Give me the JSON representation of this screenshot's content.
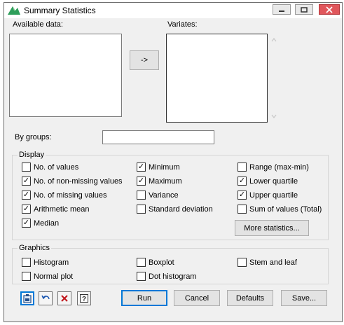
{
  "window": {
    "title": "Summary Statistics"
  },
  "available_data": {
    "label": "Available data:"
  },
  "move_button": {
    "label": "->"
  },
  "variates": {
    "label": "Variates:"
  },
  "by_groups": {
    "label": "By groups:",
    "value": ""
  },
  "display": {
    "title": "Display",
    "options": [
      {
        "label": "No. of values",
        "checked": false
      },
      {
        "label": "No. of non-missing values",
        "checked": true
      },
      {
        "label": "No. of missing values",
        "checked": true
      },
      {
        "label": "Arithmetic mean",
        "checked": true
      },
      {
        "label": "Median",
        "checked": true
      },
      {
        "label": "Minimum",
        "checked": true
      },
      {
        "label": "Maximum",
        "checked": true
      },
      {
        "label": "Variance",
        "checked": false
      },
      {
        "label": "Standard deviation",
        "checked": false
      },
      {
        "label": "Range (max-min)",
        "checked": false
      },
      {
        "label": "Lower quartile",
        "checked": true
      },
      {
        "label": "Upper quartile",
        "checked": true
      },
      {
        "label": "Sum of values (Total)",
        "checked": false
      }
    ],
    "more_button": "More statistics..."
  },
  "graphics": {
    "title": "Graphics",
    "options": [
      {
        "label": "Histogram",
        "checked": false
      },
      {
        "label": "Normal plot",
        "checked": false
      },
      {
        "label": "Boxplot",
        "checked": false
      },
      {
        "label": "Dot histogram",
        "checked": false
      },
      {
        "label": "Stem and leaf",
        "checked": false
      }
    ]
  },
  "buttons": {
    "run": "Run",
    "cancel": "Cancel",
    "defaults": "Defaults",
    "save": "Save..."
  },
  "icons": {
    "app": "genstat-logo-icon",
    "minimize": "minimize-icon",
    "maximize": "maximize-icon",
    "close": "close-icon",
    "clipboard": "clipboard-icon",
    "undo": "undo-icon",
    "clear": "clear-icon",
    "help": "help-icon"
  },
  "colors": {
    "close_button": "#e0565b",
    "focus_border": "#0078d7",
    "logo": "#2e9e5a"
  }
}
